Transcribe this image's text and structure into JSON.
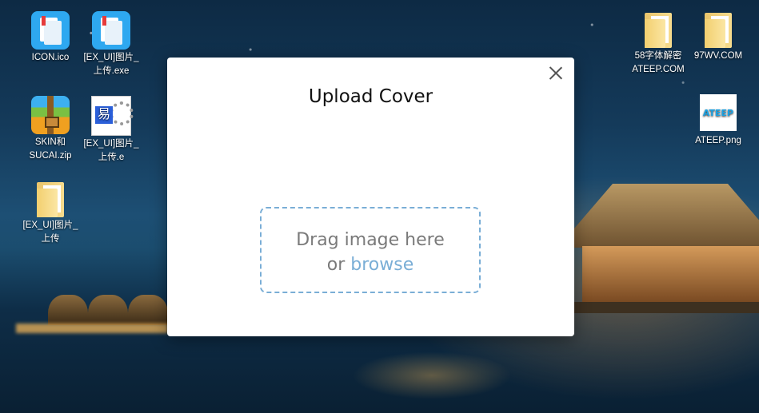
{
  "desktop": {
    "icons": [
      {
        "label": "ICON.ico"
      },
      {
        "label": "[EX_UI]图片_上传.exe"
      },
      {
        "label": "SKIN和SUCAI.zip"
      },
      {
        "label": "[EX_UI]图片_上传.e"
      },
      {
        "label": "[EX_UI]图片_上传"
      },
      {
        "label": "58字体解密ATEEP.COM"
      },
      {
        "label": "97WV.COM"
      },
      {
        "label": "ATEEP.png",
        "thumb_text": "ATEEP"
      }
    ]
  },
  "dialog": {
    "title": "Upload Cover",
    "drop_text": "Drag image here",
    "or_text": "or",
    "browse_text": "browse",
    "accent_color": "#7aaed6"
  }
}
